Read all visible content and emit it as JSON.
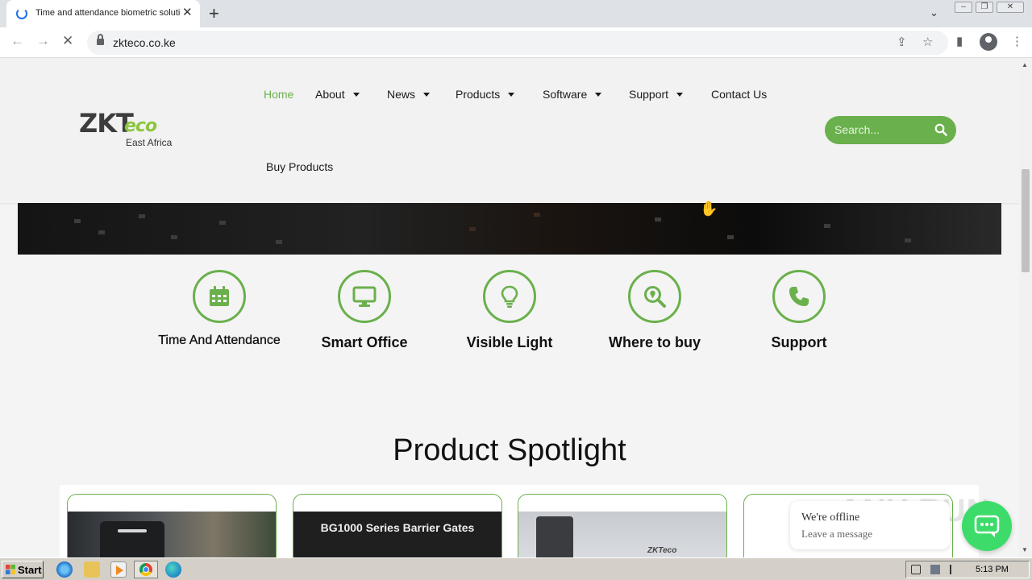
{
  "browser": {
    "tab_title": "Time and attendance biometric solutions",
    "tab_close": "✕",
    "new_tab": "+",
    "tab_dropdown": "⌄",
    "url": "zkteco.co.ke"
  },
  "site": {
    "logo_main": "ZKT",
    "logo_accent": "eco",
    "logo_sub": "East Africa",
    "nav": [
      {
        "label": "Home",
        "active": true
      },
      {
        "label": "About"
      },
      {
        "label": "News"
      },
      {
        "label": "Products"
      },
      {
        "label": "Software"
      },
      {
        "label": "Support"
      },
      {
        "label": "Contact Us"
      },
      {
        "label": "Buy Products"
      }
    ],
    "search_placeholder": "Search...",
    "accent_color": "#6ab04c"
  },
  "features": [
    {
      "label": "Time And Attendance",
      "icon": "calendar-icon"
    },
    {
      "label": "Smart Office",
      "icon": "monitor-icon"
    },
    {
      "label": "Visible Light",
      "icon": "lightbulb-icon"
    },
    {
      "label": "Where to buy",
      "icon": "search-location-icon"
    },
    {
      "label": "Support",
      "icon": "phone-icon"
    }
  ],
  "spotlight": {
    "title": "Product Spotlight",
    "cards": [
      {
        "caption": ""
      },
      {
        "caption": "BG1000 Series Barrier Gates"
      },
      {
        "caption": "ZKTeco"
      },
      {
        "caption": ""
      }
    ]
  },
  "chat": {
    "line1": "We're offline",
    "line2": "Leave a message"
  },
  "watermark": "ANY RUN",
  "taskbar": {
    "start": "Start",
    "clock": "5:13 PM"
  }
}
